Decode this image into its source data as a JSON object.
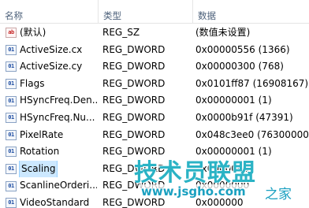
{
  "columns": {
    "name": "名称",
    "type": "类型",
    "data": "数据"
  },
  "rows": [
    {
      "icon": "string-value-icon",
      "icon_text": "ab",
      "name": "(默认)",
      "type": "REG_SZ",
      "data": "(数值未设置)"
    },
    {
      "icon": "binary-value-icon",
      "icon_text": "01",
      "name": "ActiveSize.cx",
      "type": "REG_DWORD",
      "data": "0x00000556 (1366)"
    },
    {
      "icon": "binary-value-icon",
      "icon_text": "01",
      "name": "ActiveSize.cy",
      "type": "REG_DWORD",
      "data": "0x00000300 (768)"
    },
    {
      "icon": "binary-value-icon",
      "icon_text": "01",
      "name": "Flags",
      "type": "REG_DWORD",
      "data": "0x0101ff87 (16908167)"
    },
    {
      "icon": "binary-value-icon",
      "icon_text": "01",
      "name": "HSyncFreq.Den...",
      "type": "REG_DWORD",
      "data": "0x00000001 (1)"
    },
    {
      "icon": "binary-value-icon",
      "icon_text": "01",
      "name": "HSyncFreq.Nu...",
      "type": "REG_DWORD",
      "data": "0x0000b91f (47391)"
    },
    {
      "icon": "binary-value-icon",
      "icon_text": "01",
      "name": "PixelRate",
      "type": "REG_DWORD",
      "data": "0x048c3ee0 (76300000)"
    },
    {
      "icon": "binary-value-icon",
      "icon_text": "01",
      "name": "Rotation",
      "type": "REG_DWORD",
      "data": "0x00000001 (1)"
    },
    {
      "icon": "binary-value-icon",
      "icon_text": "01",
      "name": "Scaling",
      "type": "REG_DWORD",
      "data": "0x0000000",
      "selected": true
    },
    {
      "icon": "binary-value-icon",
      "icon_text": "01",
      "name": "ScanlineOrderi...",
      "type": "REG_DWORD",
      "data": "0x0000000"
    },
    {
      "icon": "binary-value-icon",
      "icon_text": "01",
      "name": "VideoStandard",
      "type": "REG_DWORD",
      "data": "0x000000"
    }
  ],
  "watermark": {
    "main": "技术员联盟",
    "url": "www.jsgho.com",
    "suffix": "之家"
  },
  "colors": {
    "header_text": "#4c607a",
    "selection": "#cce8ff",
    "watermark": "#2bb3c5"
  }
}
